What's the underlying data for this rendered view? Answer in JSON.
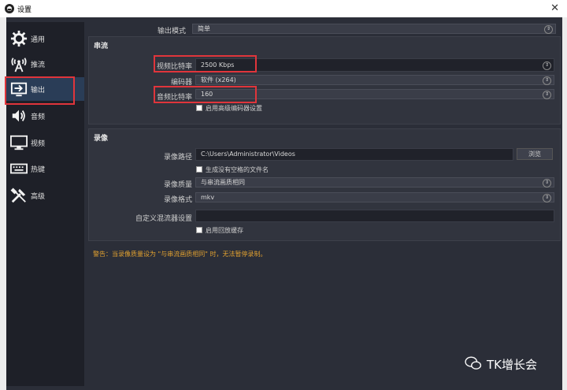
{
  "window": {
    "title": "设置",
    "close_glyph": "✕",
    "app_glyph": "◓"
  },
  "sidebar": {
    "items": [
      {
        "label": "通用",
        "icon": "gear-icon"
      },
      {
        "label": "推流",
        "icon": "antenna-icon"
      },
      {
        "label": "输出",
        "icon": "output-icon"
      },
      {
        "label": "音频",
        "icon": "speaker-icon"
      },
      {
        "label": "视频",
        "icon": "monitor-icon"
      },
      {
        "label": "热键",
        "icon": "keyboard-icon"
      },
      {
        "label": "高级",
        "icon": "tools-icon"
      }
    ],
    "active": "输出"
  },
  "output_mode": {
    "label": "输出模式",
    "value": "简单"
  },
  "streaming": {
    "title": "串流",
    "video_bitrate": {
      "label": "视频比特率",
      "value": "2500 Kbps"
    },
    "encoder": {
      "label": "编码器",
      "value": "软件 (x264)"
    },
    "audio_bitrate": {
      "label": "音频比特率",
      "value": "160"
    },
    "advanced_encoder": {
      "label": "启用高级编码器设置",
      "checked": false
    }
  },
  "recording": {
    "title": "录像",
    "path": {
      "label": "录像路径",
      "value": "C:\\Users\\Administrator\\Videos",
      "browse": "浏览"
    },
    "no_space": {
      "label": "生成没有空格的文件名",
      "checked": false
    },
    "quality": {
      "label": "录像质量",
      "value": "与串流画质相同"
    },
    "format": {
      "label": "录像格式",
      "value": "mkv"
    },
    "muxer": {
      "label": "自定义混流器设置",
      "value": ""
    },
    "replay_buffer": {
      "label": "启用回放缓存",
      "checked": false
    }
  },
  "warning": "警告：当录像质量设为 \"与串流画质相同\" 时，无法暂停录制。",
  "watermark": "TK增长会",
  "colors": {
    "highlight": "#e0353b",
    "warning": "#e0a030",
    "active_bg": "#2a3d57"
  }
}
